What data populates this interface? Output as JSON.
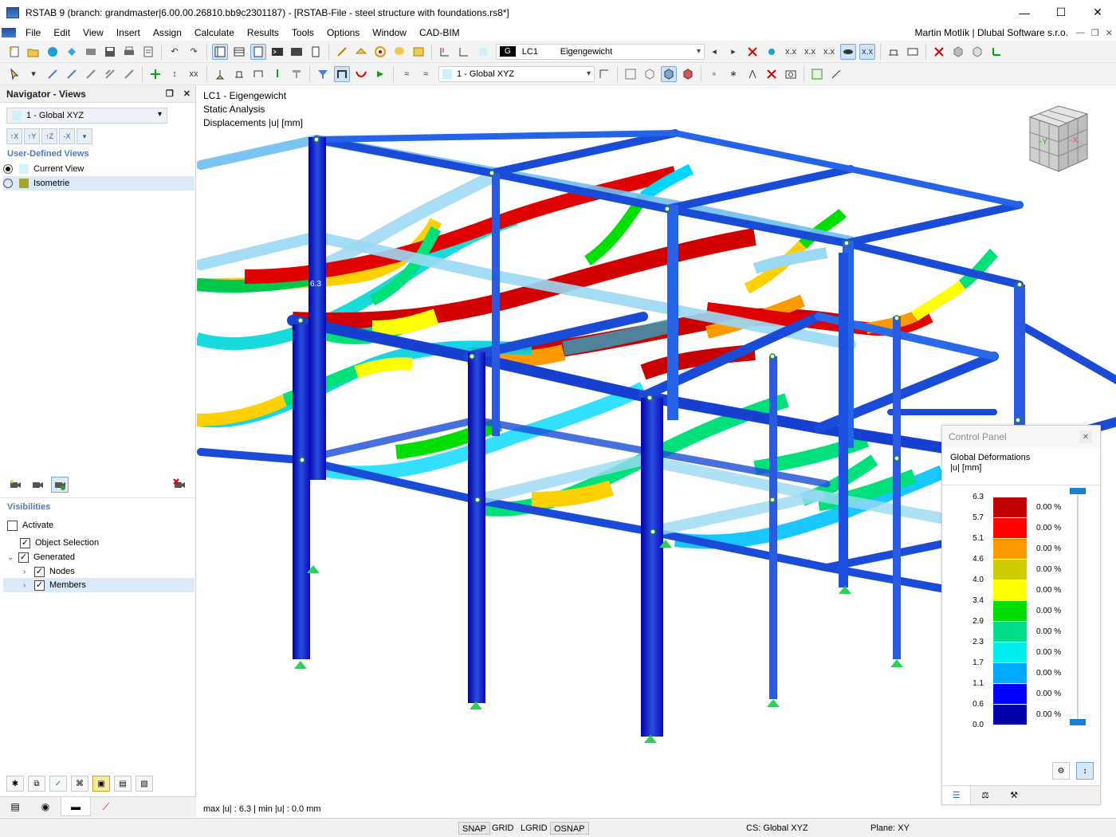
{
  "window": {
    "title": "RSTAB 9 (branch: grandmaster|6.00.00.26810.bb9c2301187) - [RSTAB-File - steel structure with foundations.rs8*]",
    "minimize": "—",
    "maximize": "☐",
    "close": "✕"
  },
  "menu": {
    "items": [
      "File",
      "Edit",
      "View",
      "Insert",
      "Assign",
      "Calculate",
      "Results",
      "Tools",
      "Options",
      "Window",
      "CAD-BIM"
    ],
    "user": "Martin Motlík | Dlubal Software s.r.o.",
    "mdi_minimize": "—",
    "mdi_restore": "❐",
    "mdi_close": "✕"
  },
  "toolbar": {
    "loadcase_badge": "G",
    "loadcase_id": "LC1",
    "loadcase_name": "Eigengewicht",
    "view_combo": "1 - Global XYZ"
  },
  "navigator": {
    "title": "Navigator - Views",
    "view_combo": "1 - Global XYZ",
    "axis_buttons": [
      "↑X",
      "↑Y",
      "↑Z",
      "-X"
    ],
    "user_defined_label": "User-Defined Views",
    "views": [
      {
        "label": "Current View",
        "selected": true
      },
      {
        "label": "Isometrie",
        "selected": false
      }
    ],
    "visibilities_label": "Visibilities",
    "activate_label": "Activate",
    "object_selection_label": "Object Selection",
    "generated_label": "Generated",
    "nodes_label": "Nodes",
    "members_label": "Members"
  },
  "viewport": {
    "info_line1": "LC1 - Eigengewicht",
    "info_line2": "Static Analysis",
    "info_line3": "Displacements |u| [mm]",
    "max_label": "6.3",
    "status": "max |u| : 6.3 | min |u| : 0.0 mm"
  },
  "control_panel": {
    "header": "Control Panel",
    "close": "✕",
    "title_line1": "Global Deformations",
    "title_line2": "|u| [mm]",
    "legend": [
      {
        "value": "6.3",
        "color": "#c00000",
        "pct": "0.00 %"
      },
      {
        "value": "5.7",
        "color": "#ff0000",
        "pct": "0.00 %"
      },
      {
        "value": "5.1",
        "color": "#ff9900",
        "pct": "0.00 %"
      },
      {
        "value": "4.6",
        "color": "#cccc00",
        "pct": "0.00 %"
      },
      {
        "value": "4.0",
        "color": "#ffff00",
        "pct": "0.00 %"
      },
      {
        "value": "3.4",
        "color": "#00dd00",
        "pct": "0.00 %"
      },
      {
        "value": "2.9",
        "color": "#00dd88",
        "pct": "0.00 %"
      },
      {
        "value": "2.3",
        "color": "#00eeee",
        "pct": "0.00 %"
      },
      {
        "value": "1.7",
        "color": "#00aaff",
        "pct": "0.00 %"
      },
      {
        "value": "1.1",
        "color": "#0000ff",
        "pct": "0.00 %"
      },
      {
        "value": "0.6",
        "color": "#0000aa",
        "pct": "0.00 %"
      },
      {
        "value": "0.0",
        "color": "",
        "pct": ""
      }
    ]
  },
  "statusbar": {
    "snap": "SNAP",
    "grid": "GRID",
    "lgrid": "LGRID",
    "osnap": "OSNAP",
    "cs": "CS: Global XYZ",
    "plane": "Plane: XY"
  }
}
